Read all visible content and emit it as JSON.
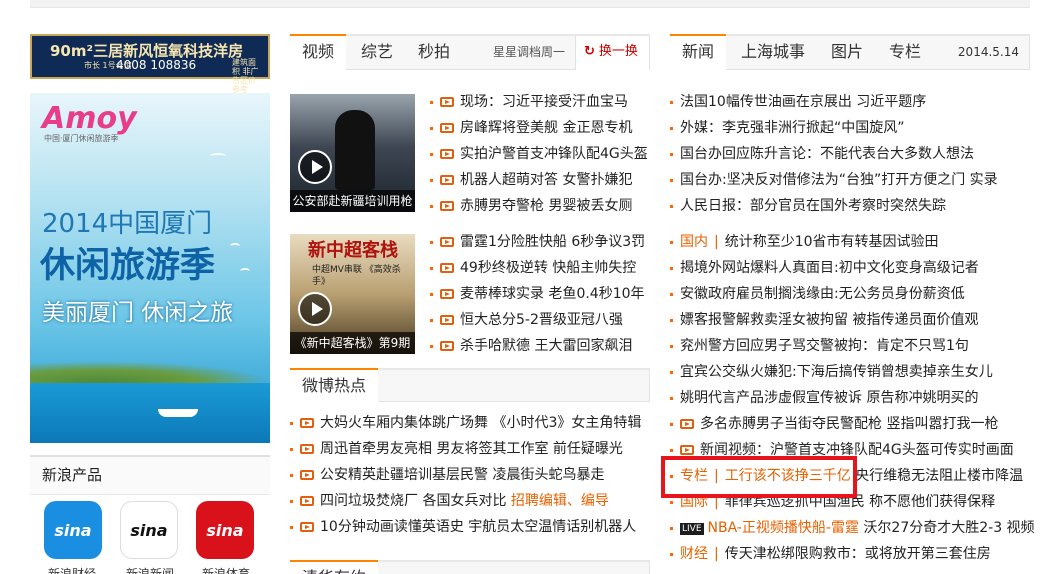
{
  "ads": {
    "top": {
      "line1": "90m²三居新风恒氧科技洋房",
      "line2": "4008 108836",
      "tag": "市长 1号公馆",
      "side": "建筑面积 非广告区价参考"
    },
    "big": {
      "logo": "Amoy",
      "logo_sub": "中国·厦门休闲旅游季",
      "title1": "2014中国厦门",
      "title2": "休闲旅游季",
      "title3": "美丽厦门 休闲之旅"
    }
  },
  "products": {
    "title": "新浪产品",
    "items": [
      {
        "icon": "sina",
        "label": "新浪财经"
      },
      {
        "icon": "sina",
        "label": "新浪新闻"
      },
      {
        "icon": "sina",
        "label": "新浪体育"
      }
    ]
  },
  "video_tabs": {
    "tabs": [
      "视频",
      "综艺",
      "秒拍"
    ],
    "extra": "星星调档周一",
    "refresh_label": "换一换"
  },
  "video_thumbs": [
    {
      "caption": "公安部赴新疆培训用枪"
    },
    {
      "caption": "《新中超客栈》第9期",
      "poster_title": "新中超客栈",
      "poster_sub": "中超MV串联  《高效杀手》"
    }
  ],
  "video_list_1": [
    "现场：习近平接受汗血宝马",
    "房峰辉将登美舰 金正恩专机",
    "实拍沪警首支冲锋队配4G头盔",
    "机器人超萌对答 女警扑嫌犯",
    "赤膊男夺警枪 男婴被丢女厕"
  ],
  "video_list_2": [
    "雷霆1分险胜快船 6秒争议3罚",
    "49秒终极逆转 快船主帅失控",
    "麦蒂棒球实录 老鱼0.4秒10年",
    "恒大总分5-2晋级亚冠八强",
    "杀手哈默德 王大雷回家飙泪"
  ],
  "weibo": {
    "title": "微博热点",
    "items": [
      {
        "text": "大妈火车厢内集体跳广场舞 《小时代3》女主角特辑"
      },
      {
        "text": "周迅首牵男友亮相 男友将签其工作室 前任疑曝光"
      },
      {
        "text": "公安精英赴疆培训基层民警 凌晨街头蛇鸟暴走"
      },
      {
        "text": "四问垃圾焚烧厂 各国女兵对比 ",
        "orange": "招聘编辑、编导"
      },
      {
        "text": "10分钟动画读懂英语史 宇航员太空温情话别机器人"
      }
    ],
    "next_title": "清华有约"
  },
  "news_tabs": {
    "tabs": [
      "新闻",
      "上海城事",
      "图片",
      "专栏"
    ],
    "date": "2014.5.14"
  },
  "news_group_1": [
    "法国10幅传世油画在京展出 习近平题序",
    "外媒：李克强非洲行掀起“中国旋风”",
    "国台办回应陈升言论：不能代表台大多数人想法",
    "国台办:坚决反对借修法为“台独”打开方便之门 实录",
    "人民日报：部分官员在国外考察时突然失踪"
  ],
  "news_group_2": [
    {
      "cat": "国内",
      "text": "统计称至少10省市有转基因试验田"
    },
    {
      "text": "揭境外网站爆料人真面目:初中文化变身高级记者"
    },
    {
      "text": "安徽政府雇员制搁浅缘由:无公务员身份薪资低"
    },
    {
      "text": "嫖客报警解救卖淫女被拘留 被指传递员面价值观"
    },
    {
      "text": "兖州警方回应男子骂交警被拘：肯定不只骂1句"
    },
    {
      "text": "宜宾公交纵火嫌犯:下海后搞传销曾想卖掉亲生女儿"
    },
    {
      "text": "姚明代言产品涉虚假宣传被诉 原告称冲姚明买的"
    },
    {
      "video": true,
      "text": "多名赤膊男子当街夺民警配枪 竖指叫嚣打我一枪"
    },
    {
      "video": true,
      "text": "新闻视频：沪警首支冲锋队配4G头盔可传实时画面"
    },
    {
      "cat": "专栏",
      "text": "工行该不该挣三千亿",
      "tail": " 央行维稳无法阻止楼市降温"
    },
    {
      "cat": "国际",
      "text": "菲律宾巡逻抓中国渔民 称不愿他们获得保释"
    },
    {
      "live": "LIVE",
      "orange": "NBA-正视频播快船-雷霆",
      "text": " 沃尔27分奇才大胜2-3 视频"
    },
    {
      "cat": "财经",
      "text": "传天津松绑限购救市：或将放开第三套住房"
    }
  ]
}
